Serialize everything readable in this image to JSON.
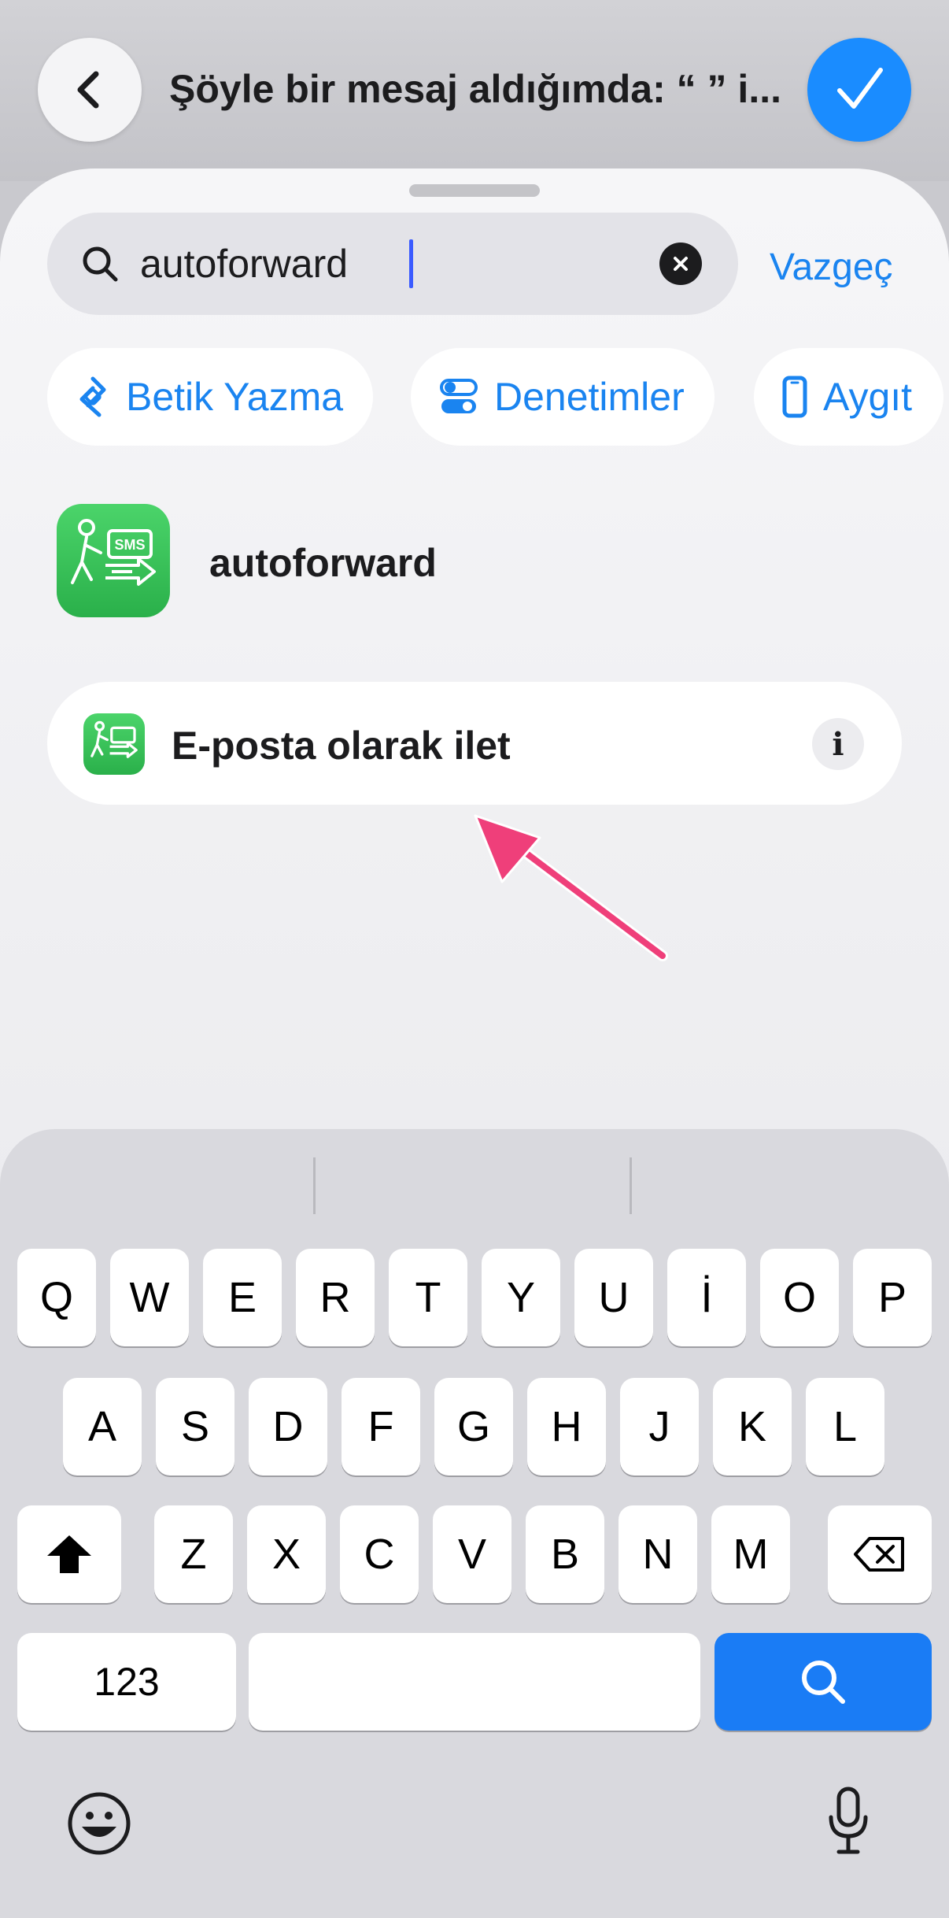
{
  "header": {
    "title": "Şöyle bir mesaj aldığımda: “ ” i..."
  },
  "search": {
    "value": "autoforward",
    "cancel_label": "Vazgeç"
  },
  "chips": [
    {
      "label": "Betik Yazma",
      "icon": "scripting-icon"
    },
    {
      "label": "Denetimler",
      "icon": "controls-toggle-icon"
    },
    {
      "label": "Aygıt",
      "icon": "phone-device-icon"
    }
  ],
  "app": {
    "name": "autoforward",
    "icon_text": "SMS"
  },
  "action": {
    "label": "E-posta olarak ilet",
    "info": "i"
  },
  "keyboard": {
    "row1": [
      "Q",
      "W",
      "E",
      "R",
      "T",
      "Y",
      "U",
      "İ",
      "O",
      "P"
    ],
    "row2": [
      "A",
      "S",
      "D",
      "F",
      "G",
      "H",
      "J",
      "K",
      "L"
    ],
    "row3": [
      "Z",
      "X",
      "C",
      "V",
      "B",
      "N",
      "M"
    ],
    "numbers_label": "123"
  },
  "colors": {
    "accent": "#1a84f0",
    "annotation_arrow": "#ef3f7a",
    "app_green": "#34c759"
  }
}
